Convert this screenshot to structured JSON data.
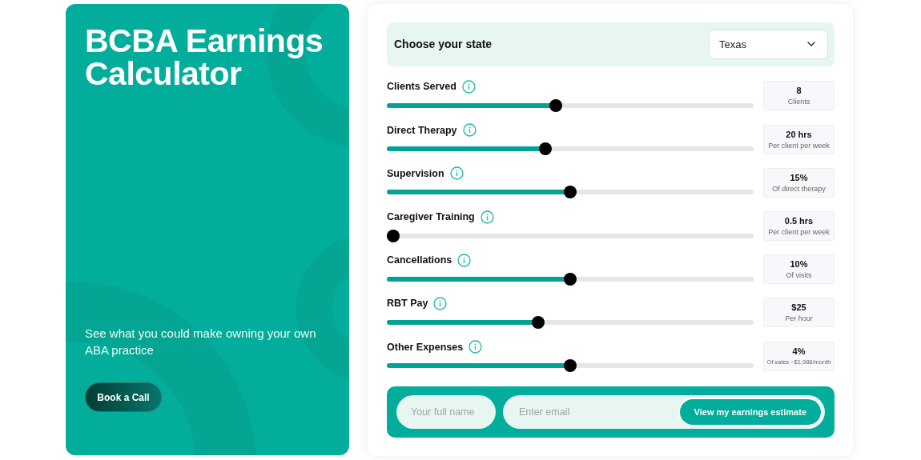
{
  "hero": {
    "title": "BCBA Earnings Calculator",
    "subtitle": "See what you could make owning your own ABA practice",
    "button": "Book a Call"
  },
  "state_picker": {
    "label": "Choose your state",
    "value": "Texas"
  },
  "sliders": [
    {
      "label": "Clients Served",
      "level": 0.46,
      "value": "8",
      "unit": "Clients"
    },
    {
      "label": "Direct Therapy",
      "level": 0.43,
      "value": "20 hrs",
      "unit": "Per client per week"
    },
    {
      "label": "Supervision",
      "level": 0.5,
      "value": "15%",
      "unit": "Of direct therapy"
    },
    {
      "label": "Caregiver Training",
      "level": 0,
      "value": "0.5 hrs",
      "unit": "Per client per week"
    },
    {
      "label": "Cancellations",
      "level": 0.5,
      "value": "10%",
      "unit": "Of visits"
    },
    {
      "label": "RBT Pay",
      "level": 0.41,
      "value": "$25",
      "unit": "Per hour"
    },
    {
      "label": "Other Expenses",
      "level": 0.5,
      "value": "4%",
      "unit": "Of sales ~$1,988/month"
    }
  ],
  "lead_form": {
    "name_placeholder": "Your full name",
    "email_placeholder": "Enter email",
    "button": "View my earnings estimate"
  }
}
